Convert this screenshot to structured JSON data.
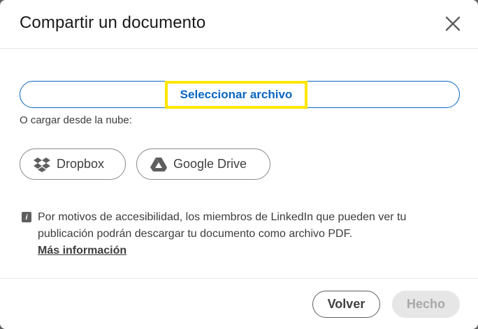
{
  "dialog": {
    "title": "Compartir un documento"
  },
  "upload": {
    "select_label": "Seleccionar archivo",
    "cloud_label": "O cargar desde la nube:"
  },
  "cloud_buttons": {
    "dropbox": "Dropbox",
    "google_drive": "Google Drive"
  },
  "info": {
    "text": "Por motivos de accesibilidad, los miembros de LinkedIn que pueden ver tu publicación podrán descargar tu documento como archivo PDF.",
    "link": "Más información"
  },
  "footer": {
    "back_label": "Volver",
    "done_label": "Hecho"
  },
  "colors": {
    "accent": "#0a66c2",
    "highlight": "#ffe600",
    "disabled_bg": "#e6e6e6"
  },
  "icons": {
    "close": "close-icon",
    "dropbox": "dropbox-icon",
    "google_drive": "google-drive-icon",
    "info": "info-icon"
  }
}
